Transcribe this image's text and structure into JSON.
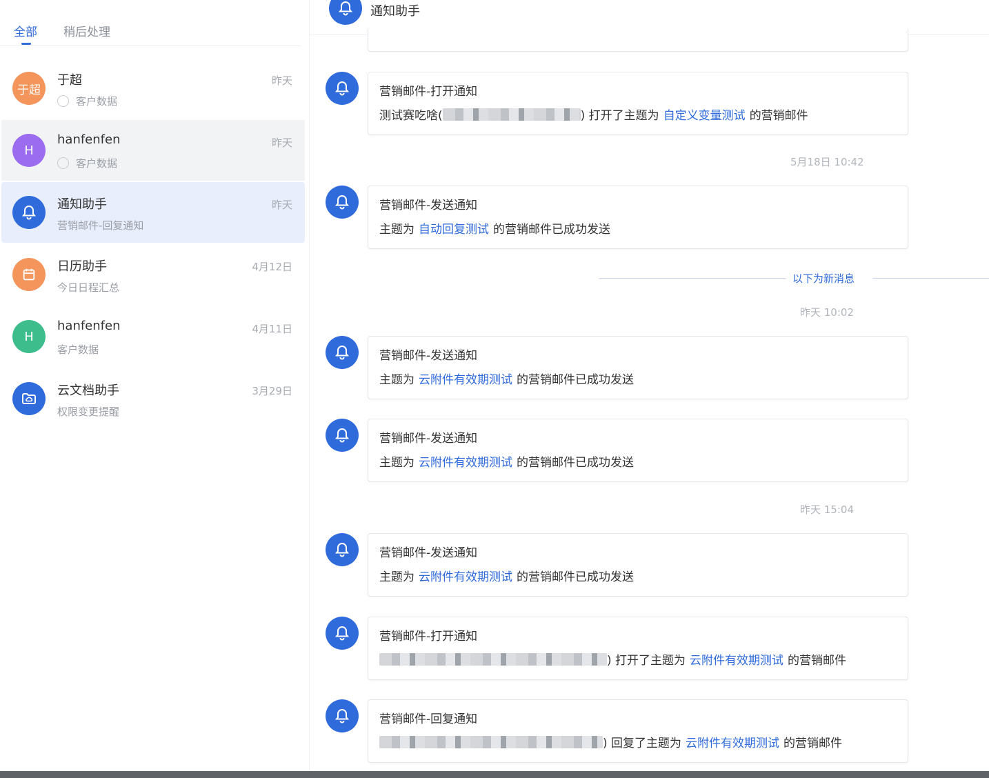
{
  "tabs": [
    {
      "label": "全部",
      "active": true
    },
    {
      "label": "稍后处理",
      "active": false
    }
  ],
  "conversations": [
    {
      "avatar_text": "于超",
      "avatar_color": "#f4955b",
      "name": "于超",
      "subtitle": "客户数据",
      "time": "昨天",
      "has_radio": true,
      "state": "normal"
    },
    {
      "avatar_text": "H",
      "avatar_color": "#9c6cf0",
      "name": "hanfenfen",
      "subtitle": "客户数据",
      "time": "昨天",
      "has_radio": true,
      "state": "hover"
    },
    {
      "avatar_icon": "bell-icon",
      "avatar_color": "#2f6bdb",
      "name": "通知助手",
      "subtitle": "营销邮件-回复通知",
      "time": "昨天",
      "has_radio": false,
      "state": "selected"
    },
    {
      "avatar_icon": "calendar-icon",
      "avatar_color": "#f4955b",
      "name": "日历助手",
      "subtitle": "今日日程汇总",
      "time": "4月12日",
      "has_radio": false,
      "state": "normal"
    },
    {
      "avatar_text": "H",
      "avatar_color": "#3dbd8c",
      "name": "hanfenfen",
      "subtitle": "客户数据",
      "time": "4月11日",
      "has_radio": false,
      "state": "normal"
    },
    {
      "avatar_icon": "cloud-folder-icon",
      "avatar_color": "#2f6bdb",
      "name": "云文档助手",
      "subtitle": "权限变更提醒",
      "time": "3月29日",
      "has_radio": false,
      "state": "normal"
    }
  ],
  "chat": {
    "title": "通知助手",
    "new_message_label": "以下为新消息",
    "timestamps": [
      "5月18日 10:42",
      "昨天 10:02",
      "昨天 15:04"
    ],
    "messages": [
      {
        "title": "营销邮件-打开通知",
        "prefix": "测试赛吃啥(",
        "redacted": true,
        "action": ") 打开了主题为",
        "link": "自定义变量测试",
        "suffix": "的营销邮件"
      },
      {
        "title": "营销邮件-发送通知",
        "prefix": "主题为",
        "redacted": false,
        "action": "",
        "link": "自动回复测试",
        "suffix": "的营销邮件已成功发送"
      },
      {
        "title": "营销邮件-发送通知",
        "prefix": "主题为",
        "redacted": false,
        "action": "",
        "link": "云附件有效期测试",
        "suffix": "的营销邮件已成功发送"
      },
      {
        "title": "营销邮件-发送通知",
        "prefix": "主题为",
        "redacted": false,
        "action": "",
        "link": "云附件有效期测试",
        "suffix": "的营销邮件已成功发送"
      },
      {
        "title": "营销邮件-发送通知",
        "prefix": "主题为",
        "redacted": false,
        "action": "",
        "link": "云附件有效期测试",
        "suffix": "的营销邮件已成功发送"
      },
      {
        "title": "营销邮件-打开通知",
        "prefix": "",
        "redacted": true,
        "action": ") 打开了主题为",
        "link": "云附件有效期测试",
        "suffix": "的营销邮件"
      },
      {
        "title": "营销邮件-回复通知",
        "prefix": "",
        "redacted": true,
        "action": ") 回复了主题为",
        "link": "云附件有效期测试",
        "suffix": "的营销邮件"
      }
    ]
  },
  "colors": {
    "accent": "#2f6bdb",
    "selected_bg": "#e8eefc",
    "hover_bg": "#f2f3f5"
  }
}
